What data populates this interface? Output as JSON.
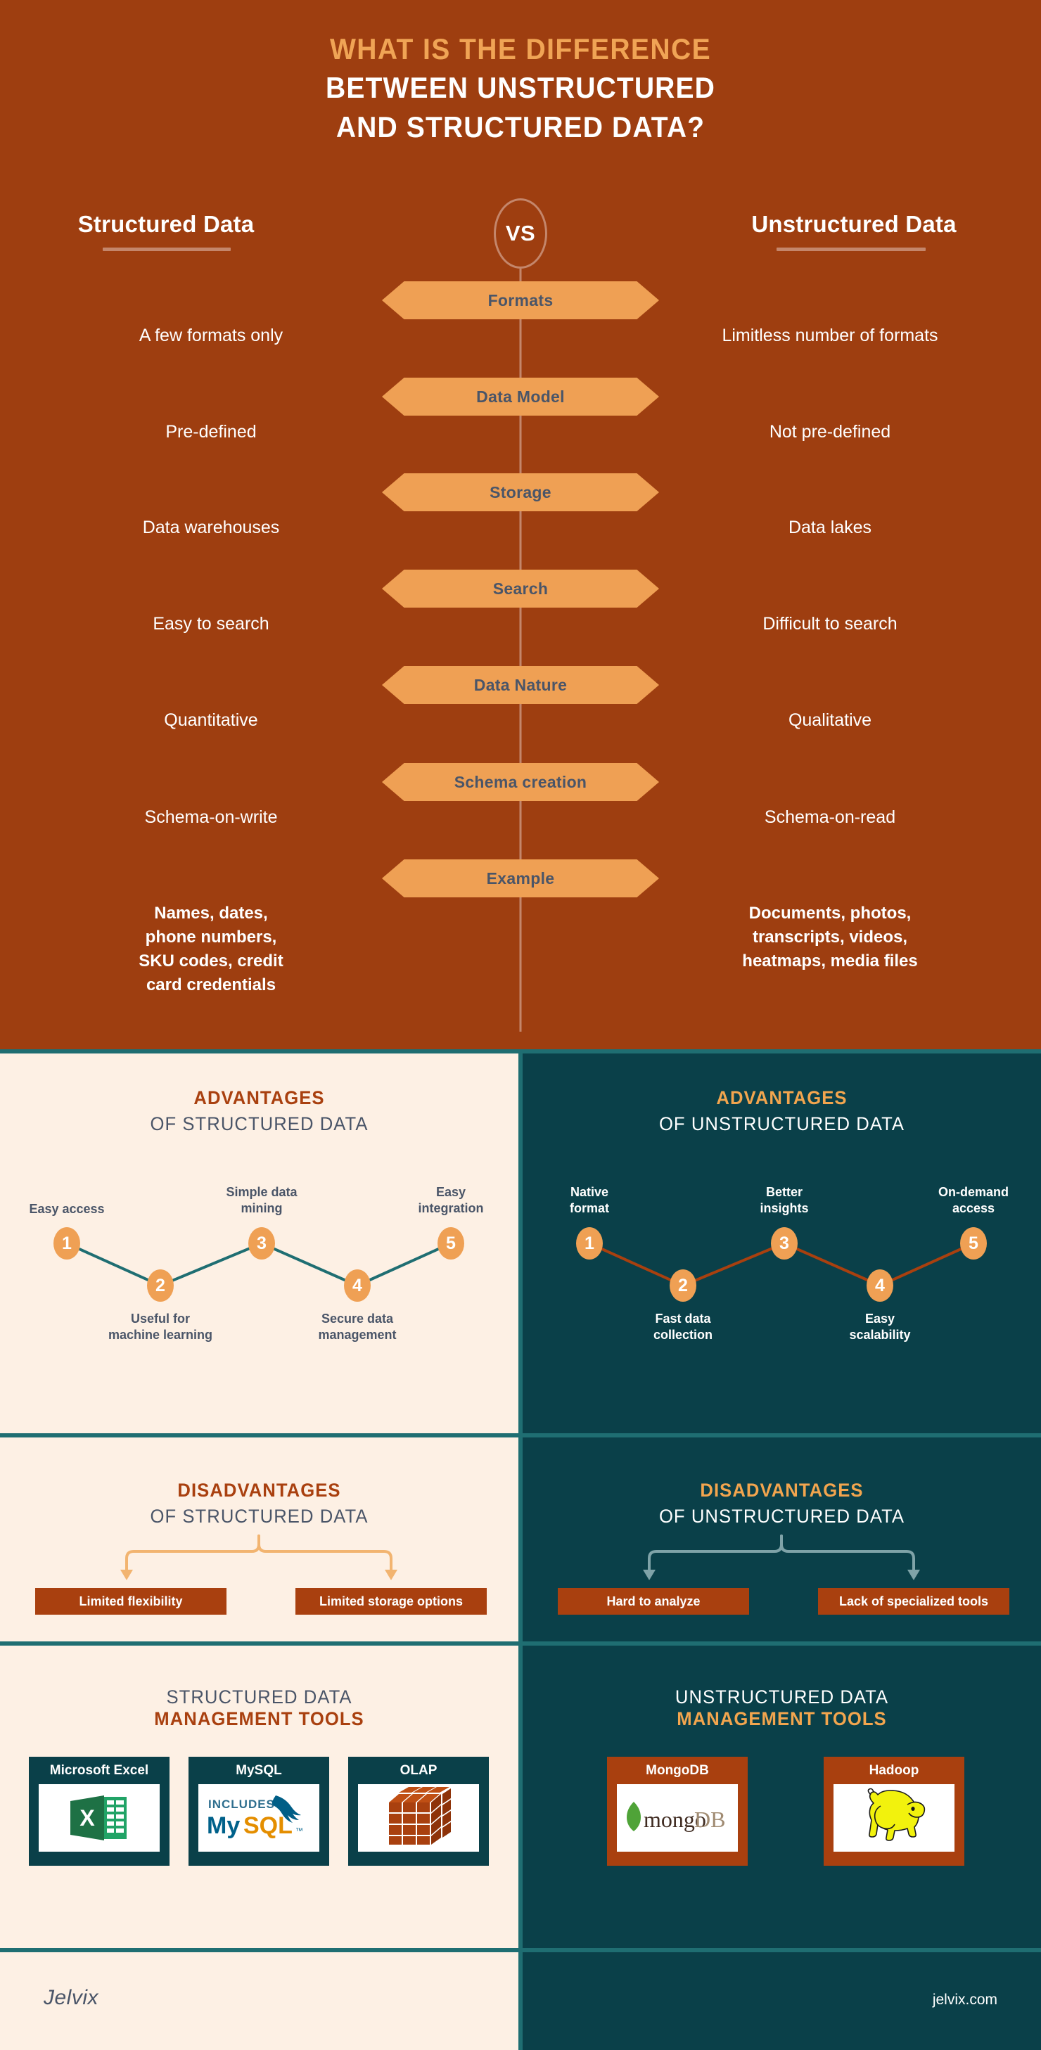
{
  "hero": {
    "title_line1": "WHAT IS THE DIFFERENCE",
    "title_line2": "BETWEEN UNSTRUCTURED",
    "title_line3": "AND STRUCTURED DATA?",
    "left_column_title": "Structured Data",
    "right_column_title": "Unstructured Data",
    "vs_label": "VS"
  },
  "comparison": {
    "rows": [
      {
        "banner": "Formats",
        "left": "A few formats only",
        "right": "Limitless number of formats"
      },
      {
        "banner": "Data Model",
        "left": "Pre-defined",
        "right": "Not pre-defined"
      },
      {
        "banner": "Storage",
        "left": "Data warehouses",
        "right": "Data lakes"
      },
      {
        "banner": "Search",
        "left": "Easy to search",
        "right": "Difficult to search"
      },
      {
        "banner": "Data Nature",
        "left": "Quantitative",
        "right": "Qualitative"
      },
      {
        "banner": "Schema creation",
        "left": "Schema-on-write",
        "right": "Schema-on-read"
      },
      {
        "banner": "Example",
        "left": "Names, dates,\nphone numbers,\nSKU codes, credit\ncard credentials",
        "right": "Documents, photos,\ntranscripts, videos,\nheatmaps, media files"
      }
    ]
  },
  "advantages_structured": {
    "title_top": "ADVANTAGES",
    "title_bottom": "OF STRUCTURED DATA",
    "nodes": [
      {
        "num": "1",
        "label": "Easy access"
      },
      {
        "num": "2",
        "label": "Useful for\nmachine learning"
      },
      {
        "num": "3",
        "label": "Simple data\nmining"
      },
      {
        "num": "4",
        "label": "Secure data\nmanagement"
      },
      {
        "num": "5",
        "label": "Easy\nintegration"
      }
    ],
    "line_color": "#1F6E72",
    "node_color": "#EFA054"
  },
  "advantages_unstructured": {
    "title_top": "ADVANTAGES",
    "title_bottom": "OF UNSTRUCTURED DATA",
    "nodes": [
      {
        "num": "1",
        "label": "Native\nformat"
      },
      {
        "num": "2",
        "label": "Fast data\ncollection"
      },
      {
        "num": "3",
        "label": "Better\ninsights"
      },
      {
        "num": "4",
        "label": "Easy\nscalability"
      },
      {
        "num": "5",
        "label": "On-demand\naccess"
      }
    ],
    "line_color": "#A9400F",
    "node_color": "#EFA054"
  },
  "disadvantages_structured": {
    "title_top": "DISADVANTAGES",
    "title_bottom": "OF STRUCTURED DATA",
    "items": [
      "Limited flexibility",
      "Limited storage options"
    ],
    "arrow_color": "#F2B470"
  },
  "disadvantages_unstructured": {
    "title_top": "DISADVANTAGES",
    "title_bottom": "OF UNSTRUCTURED DATA",
    "items": [
      "Hard to analyze",
      "Lack of specialized tools"
    ],
    "arrow_color": "#7FA3A8"
  },
  "tools_structured": {
    "title_top": "STRUCTURED DATA",
    "title_bottom": "MANAGEMENT TOOLS",
    "items": [
      {
        "name": "Microsoft Excel",
        "logo": "excel-logo"
      },
      {
        "name": "MySQL",
        "logo": "mysql-logo"
      },
      {
        "name": "OLAP",
        "logo": "olap-cube-logo"
      }
    ]
  },
  "tools_unstructured": {
    "title_top": "UNSTRUCTURED DATA",
    "title_bottom": "MANAGEMENT TOOLS",
    "items": [
      {
        "name": "MongoDB",
        "logo": "mongodb-logo"
      },
      {
        "name": "Hadoop",
        "logo": "hadoop-elephant-logo"
      }
    ]
  },
  "mysql_logo": {
    "includes": "INCLUDES",
    "my": "My",
    "sql": "SQL",
    "tm": "™"
  },
  "mongodb_logo": {
    "mongo": "mongo",
    "db": "DB"
  },
  "excel_logo": {
    "letter": "X"
  },
  "footer": {
    "brand": "Jelvix",
    "url": "jelvix.com"
  },
  "colors": {
    "brown": "#9E3E10",
    "dark_brown": "#A9400F",
    "orange": "#EFA054",
    "light_orange": "#F2A54E",
    "cream": "#FDF0E4",
    "teal_dark": "#0A4049",
    "teal_line": "#1F6E72",
    "slate": "#4A5568"
  }
}
